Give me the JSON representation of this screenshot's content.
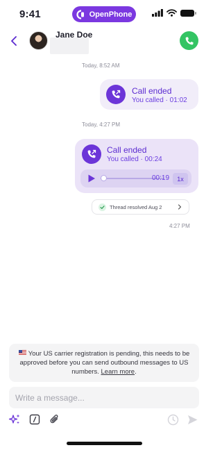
{
  "status_bar": {
    "time": "9:41",
    "app_name": "OpenPhone"
  },
  "header": {
    "contact_name": "Jane Doe",
    "avatar_color": "#2d2520",
    "call_button_color": "#33c463"
  },
  "conversation": {
    "timestamp_1": "Today, 8:52 AM",
    "call_1": {
      "title": "Call ended",
      "subtitle": "You called · 01:02"
    },
    "timestamp_2": "Today, 4:27 PM",
    "call_2": {
      "title": "Call ended",
      "subtitle": "You called · 00:24",
      "player": {
        "duration": "00:19",
        "speed": "1x",
        "progress": 0.04
      }
    },
    "thread_status": "Thread resolved Aug 2",
    "message_time": "4:27 PM"
  },
  "notice": {
    "text": "Your US carrier registration is pending, this needs to be approved before you can send outbound messages to US numbers.",
    "link": "Learn more",
    "suffix": "."
  },
  "composer": {
    "placeholder": "Write a message..."
  },
  "colors": {
    "accent": "#6c35d8",
    "brand": "#7b38e0",
    "success": "#33c463"
  },
  "icons": [
    "back-icon",
    "openphone-logo-icon",
    "signal-icon",
    "wifi-icon",
    "battery-icon",
    "phone-icon",
    "outgoing-call-icon",
    "play-icon",
    "check-icon",
    "chevron-right-icon",
    "us-flag-icon",
    "sparkles-icon",
    "slash-command-icon",
    "paperclip-icon",
    "schedule-icon",
    "send-icon"
  ]
}
